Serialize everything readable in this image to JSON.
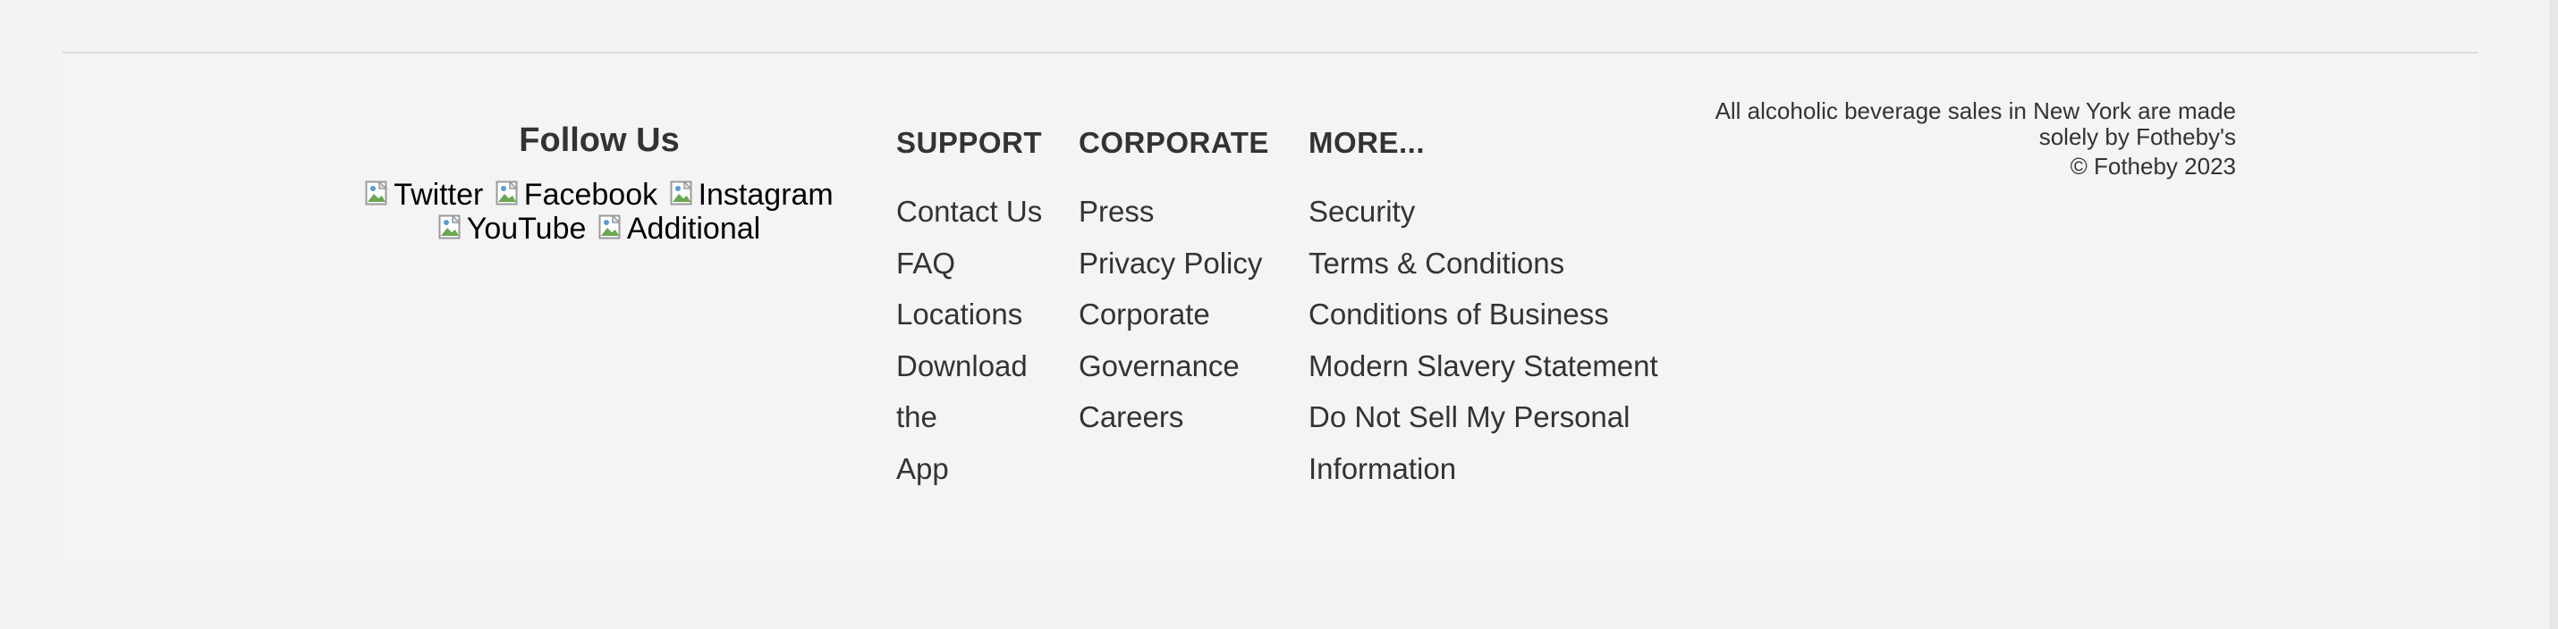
{
  "follow": {
    "title": "Follow Us",
    "social": [
      {
        "label": "Twitter",
        "icon": "broken-image-icon"
      },
      {
        "label": "Facebook",
        "icon": "broken-image-icon"
      },
      {
        "label": "Instagram",
        "icon": "broken-image-icon"
      },
      {
        "label": "YouTube",
        "icon": "broken-image-icon"
      },
      {
        "label": "Additional",
        "icon": "broken-image-icon"
      }
    ]
  },
  "support": {
    "title": "SUPPORT",
    "links": [
      "Contact Us",
      "FAQ",
      "Locations",
      "Download the",
      "App"
    ]
  },
  "corporate": {
    "title": "CORPORATE",
    "links": [
      "Press",
      "Privacy Policy",
      "Corporate",
      "Governance",
      "Careers"
    ]
  },
  "more": {
    "title": "MORE...",
    "links": [
      "Security",
      "Terms & Conditions",
      "Conditions of Business",
      "Modern Slavery Statement",
      "Do Not Sell My Personal",
      "Information"
    ]
  },
  "legal": {
    "line1": "All alcoholic beverage sales in New York are made",
    "line2": "solely by Fotheby's",
    "copyright": "© Fotheby 2023"
  },
  "colors": {
    "page_background": "#f4f3f2",
    "text": "#333333",
    "divider": "#dcdcdc"
  }
}
